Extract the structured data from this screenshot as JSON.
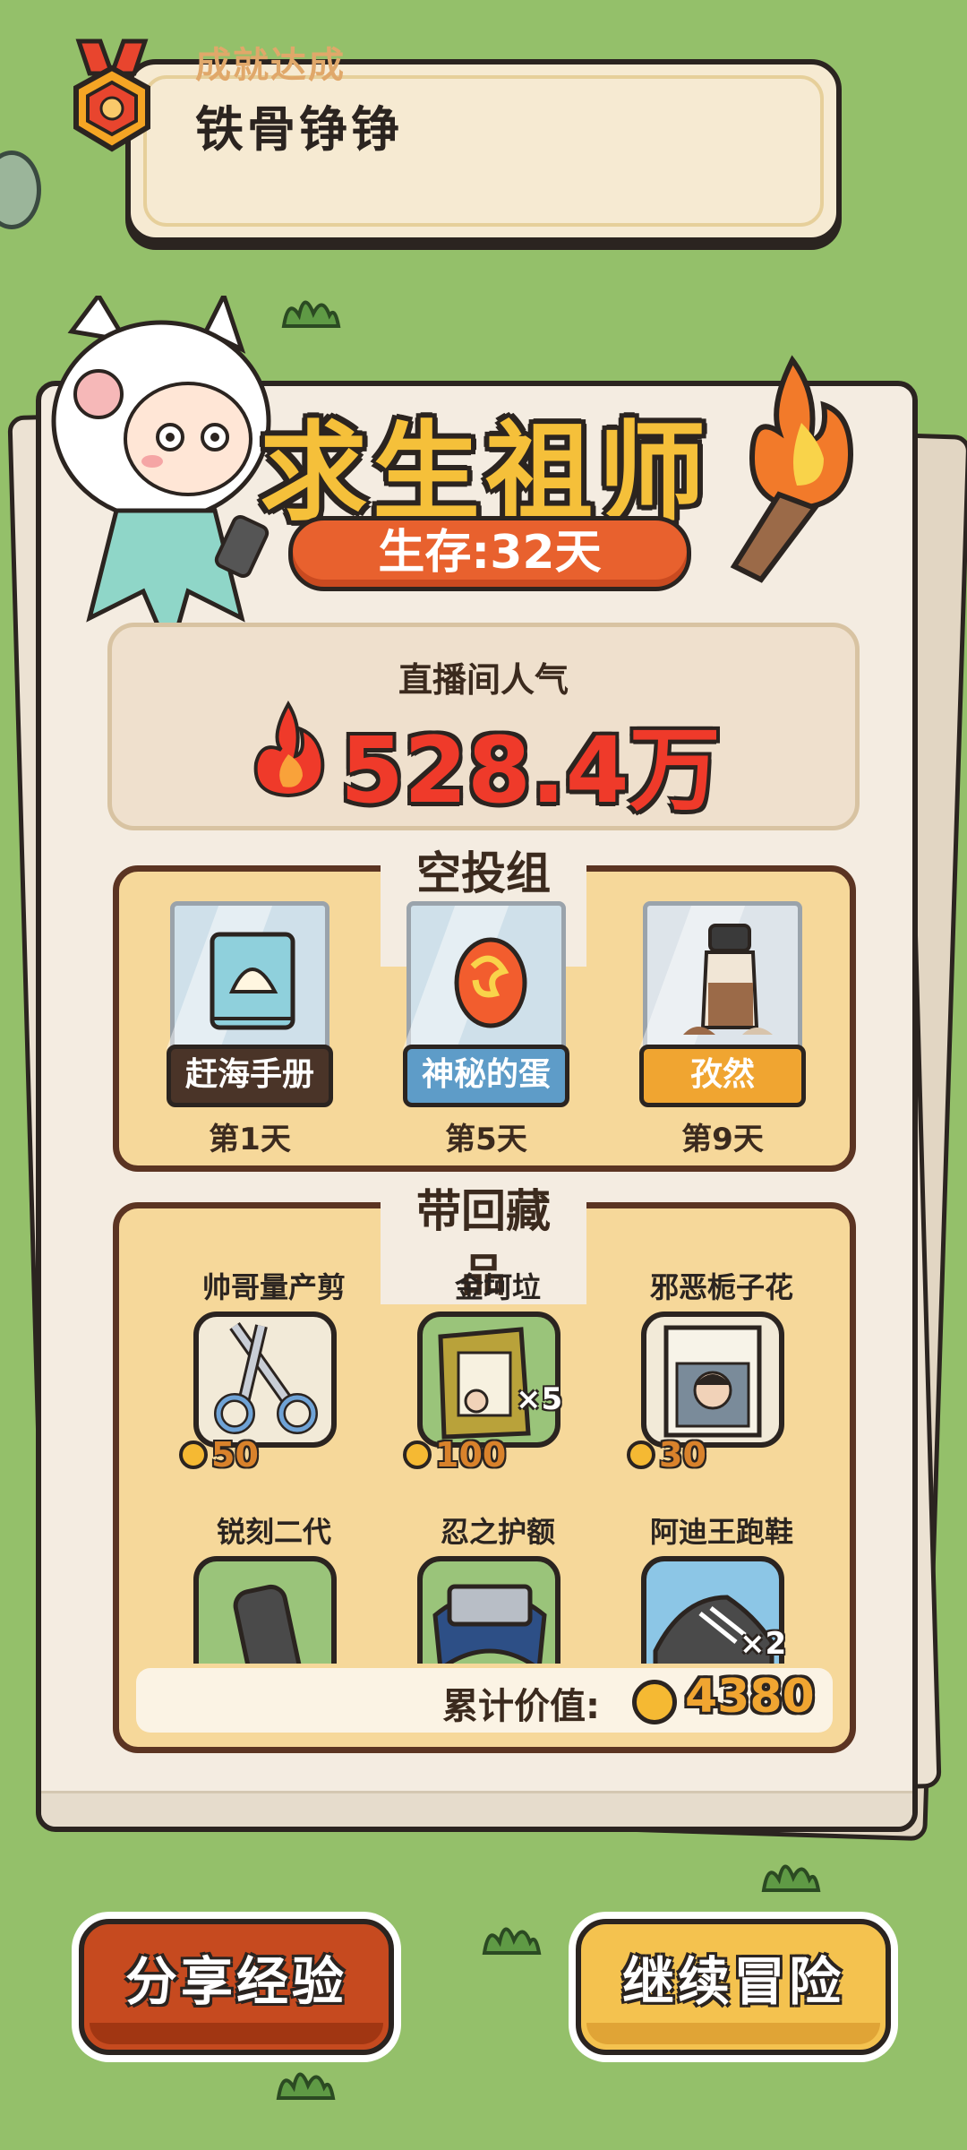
{
  "achievement": {
    "subtitle": "成就达成",
    "title": "铁骨铮铮",
    "icon": "medal-icon"
  },
  "header": {
    "title": "求生祖师",
    "survival": "生存:32天"
  },
  "popularity": {
    "label": "直播间人气",
    "value": "528.4万",
    "icon": "fire-icon"
  },
  "airdrop": {
    "title": "空投组合",
    "items": [
      {
        "name": "赶海手册",
        "day": "第1天",
        "icon": "shell-book-icon",
        "label_bg": "#4a3428",
        "label_color": "#ffffff"
      },
      {
        "name": "神秘的蛋",
        "day": "第5天",
        "icon": "mystery-egg-icon",
        "label_bg": "#5e9cc8",
        "label_color": "#ffffff"
      },
      {
        "name": "孜然",
        "day": "第9天",
        "icon": "spice-jar-icon",
        "label_bg": "#f0a531",
        "label_color": "#ffffff"
      }
    ]
  },
  "collection": {
    "title": "带回藏品",
    "items": [
      {
        "name": "帅哥量产剪",
        "price": "50",
        "icon": "scissors-icon",
        "bg": "#f2ead8"
      },
      {
        "name": "金坷垃",
        "price": "100",
        "icon": "fertilizer-bag-icon",
        "bg": "#9ac47a",
        "badge": "×5"
      },
      {
        "name": "邪恶栀子花",
        "price": "30",
        "icon": "book-cover-icon",
        "bg": "#f2ead8"
      },
      {
        "name": "锐刻二代",
        "icon": "vape-icon",
        "bg": "#9ac47a"
      },
      {
        "name": "忍之护额",
        "icon": "headband-icon",
        "bg": "#9ac47a"
      },
      {
        "name": "阿迪王跑鞋",
        "icon": "sneaker-icon",
        "bg": "#8cc6e6",
        "badge": "×2"
      }
    ],
    "total_label": "累计价值:",
    "total_value": "4380"
  },
  "buttons": {
    "share": "分享经验",
    "continue": "继续冒险"
  }
}
